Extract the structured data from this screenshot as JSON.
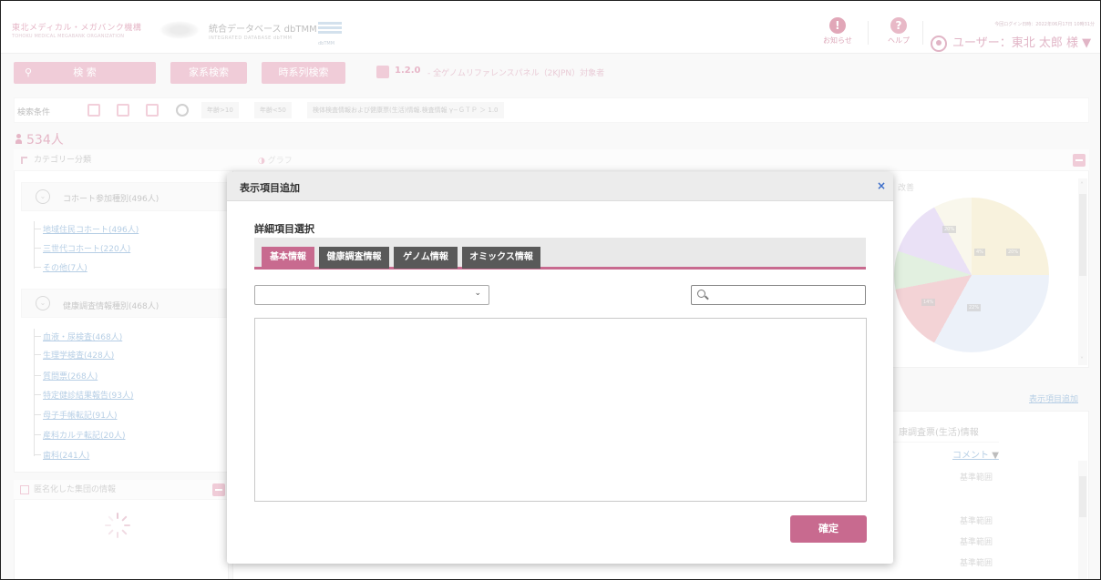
{
  "header": {
    "logo1_main": "東北メディカル・メガバンク機構",
    "logo1_sub": "TOHOKU MEDICAL MEGABANK ORGANIZATION",
    "logo2_main": "統合データベース dbTMM",
    "logo2_sub": "INTEGRATED DATABASE dbTMM",
    "logo2_mark": "dbTMM",
    "notice_label": "お知らせ",
    "help_label": "ヘルプ",
    "last_login": "今回ログイン日時：2022年06月17日 10時31分",
    "user_label": "ユーザー：東北 太郎 様 ▼"
  },
  "toolbar": {
    "search_btn": "検 索",
    "period_btn": "家系検索",
    "timeseries_btn": "時系列検索",
    "version": "1.2.0",
    "version_desc": "- 全ゲノムリファレンスパネル（2KJPN）対象者"
  },
  "conditions": {
    "label": "検索条件",
    "chips": [
      "年齢>10",
      "年齢<50",
      "検体検査情報および健康票(生活)情報.検査情報 γ−ＧＴＰ ＞ 1.0"
    ]
  },
  "count": "534人",
  "left": {
    "panel_title": "カテゴリー分類",
    "group1_title": "コホート参加種別(496人)",
    "group1_items": [
      "地域住民コホート(496人)",
      "三世代コホート(220人)",
      "その他(7人)"
    ],
    "group2_title": "健康調査情報種別(468人)",
    "group2_items": [
      "血液・尿検査(468人)",
      "生理学検査(428人)",
      "質問票(268人)",
      "特定健診結果報告(93人)",
      "母子手帳転記(91人)",
      "産科カルテ転記(20人)",
      "歯科(241人)"
    ],
    "panel2_title": "匿名化した集団の情報"
  },
  "right": {
    "graph_title": "グラフ",
    "pie_header": "改善",
    "add_display_link": "表示項目追加",
    "table_header_group": "康調査票(生活)情報",
    "table_header_comment": "コメント",
    "rows": [
      "基準範囲",
      "",
      "基準範囲",
      "基準範囲",
      "基準範囲"
    ],
    "pie_labels": [
      "20%",
      "4%",
      "20%",
      "14%",
      "22%"
    ]
  },
  "modal": {
    "title": "表示項目追加",
    "close": "×",
    "section_label": "詳細項目選択",
    "tabs": [
      "基本情報",
      "健康調査情報",
      "ゲノム情報",
      "オミックス情報"
    ],
    "select_value": "",
    "search_value": "",
    "search_placeholder": "",
    "confirm_label": "確定"
  },
  "colors": {
    "accent": "#c86a8f",
    "tab_inactive": "#595959",
    "close": "#3a6cc9",
    "link": "#7ba7d0"
  }
}
